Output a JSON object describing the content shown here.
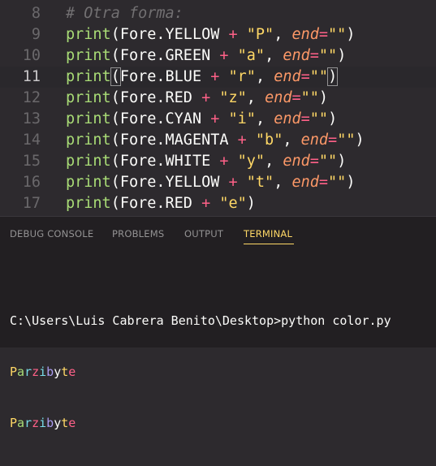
{
  "editor": {
    "lines": [
      {
        "num": "8",
        "parts": [
          {
            "t": "# Otra forma:",
            "c": "cm"
          }
        ]
      },
      {
        "num": "9",
        "parts": [
          {
            "t": "print",
            "c": "kw"
          },
          {
            "t": "(Fore.YELLOW ",
            "c": "pl"
          },
          {
            "t": "+",
            "c": "op"
          },
          {
            "t": " \"P\"",
            "c": "str"
          },
          {
            "t": ", ",
            "c": "pl"
          },
          {
            "t": "end",
            "c": "arg"
          },
          {
            "t": "=",
            "c": "op"
          },
          {
            "t": "\"\"",
            "c": "str"
          },
          {
            "t": ")",
            "c": "pl"
          }
        ]
      },
      {
        "num": "10",
        "parts": [
          {
            "t": "print",
            "c": "kw"
          },
          {
            "t": "(Fore.GREEN ",
            "c": "pl"
          },
          {
            "t": "+",
            "c": "op"
          },
          {
            "t": " \"a\"",
            "c": "str"
          },
          {
            "t": ", ",
            "c": "pl"
          },
          {
            "t": "end",
            "c": "arg"
          },
          {
            "t": "=",
            "c": "op"
          },
          {
            "t": "\"\"",
            "c": "str"
          },
          {
            "t": ")",
            "c": "pl"
          }
        ]
      },
      {
        "num": "11",
        "parts": [
          {
            "t": "print",
            "c": "kw"
          },
          {
            "t": "(",
            "c": "pl bracket-box"
          },
          {
            "t": "Fore.BLUE ",
            "c": "pl"
          },
          {
            "t": "+",
            "c": "op"
          },
          {
            "t": " \"r\"",
            "c": "str"
          },
          {
            "t": ", ",
            "c": "pl"
          },
          {
            "t": "end",
            "c": "arg"
          },
          {
            "t": "=",
            "c": "op"
          },
          {
            "t": "\"\"",
            "c": "str"
          },
          {
            "t": ")",
            "c": "pl bracket-box"
          }
        ]
      },
      {
        "num": "12",
        "parts": [
          {
            "t": "print",
            "c": "kw"
          },
          {
            "t": "(Fore.RED ",
            "c": "pl"
          },
          {
            "t": "+",
            "c": "op"
          },
          {
            "t": " \"z\"",
            "c": "str"
          },
          {
            "t": ", ",
            "c": "pl"
          },
          {
            "t": "end",
            "c": "arg"
          },
          {
            "t": "=",
            "c": "op"
          },
          {
            "t": "\"\"",
            "c": "str"
          },
          {
            "t": ")",
            "c": "pl"
          }
        ]
      },
      {
        "num": "13",
        "parts": [
          {
            "t": "print",
            "c": "kw"
          },
          {
            "t": "(Fore.CYAN ",
            "c": "pl"
          },
          {
            "t": "+",
            "c": "op"
          },
          {
            "t": " \"i\"",
            "c": "str"
          },
          {
            "t": ", ",
            "c": "pl"
          },
          {
            "t": "end",
            "c": "arg"
          },
          {
            "t": "=",
            "c": "op"
          },
          {
            "t": "\"\"",
            "c": "str"
          },
          {
            "t": ")",
            "c": "pl"
          }
        ]
      },
      {
        "num": "14",
        "parts": [
          {
            "t": "print",
            "c": "kw"
          },
          {
            "t": "(Fore.MAGENTA ",
            "c": "pl"
          },
          {
            "t": "+",
            "c": "op"
          },
          {
            "t": " \"b\"",
            "c": "str"
          },
          {
            "t": ", ",
            "c": "pl"
          },
          {
            "t": "end",
            "c": "arg"
          },
          {
            "t": "=",
            "c": "op"
          },
          {
            "t": "\"\"",
            "c": "str"
          },
          {
            "t": ")",
            "c": "pl"
          }
        ]
      },
      {
        "num": "15",
        "parts": [
          {
            "t": "print",
            "c": "kw"
          },
          {
            "t": "(Fore.WHITE ",
            "c": "pl"
          },
          {
            "t": "+",
            "c": "op"
          },
          {
            "t": " \"y\"",
            "c": "str"
          },
          {
            "t": ", ",
            "c": "pl"
          },
          {
            "t": "end",
            "c": "arg"
          },
          {
            "t": "=",
            "c": "op"
          },
          {
            "t": "\"\"",
            "c": "str"
          },
          {
            "t": ")",
            "c": "pl"
          }
        ]
      },
      {
        "num": "16",
        "parts": [
          {
            "t": "print",
            "c": "kw"
          },
          {
            "t": "(Fore.YELLOW ",
            "c": "pl"
          },
          {
            "t": "+",
            "c": "op"
          },
          {
            "t": " \"t\"",
            "c": "str"
          },
          {
            "t": ", ",
            "c": "pl"
          },
          {
            "t": "end",
            "c": "arg"
          },
          {
            "t": "=",
            "c": "op"
          },
          {
            "t": "\"\"",
            "c": "str"
          },
          {
            "t": ")",
            "c": "pl"
          }
        ]
      },
      {
        "num": "17",
        "parts": [
          {
            "t": "print",
            "c": "kw"
          },
          {
            "t": "(Fore.RED ",
            "c": "pl"
          },
          {
            "t": "+",
            "c": "op"
          },
          {
            "t": " \"e\"",
            "c": "str"
          },
          {
            "t": ")",
            "c": "pl"
          }
        ]
      }
    ],
    "current_line": "11"
  },
  "panel": {
    "tabs": [
      {
        "label": "DEBUG CONSOLE",
        "active": false
      },
      {
        "label": "PROBLEMS",
        "active": false
      },
      {
        "label": "OUTPUT",
        "active": false
      },
      {
        "label": "TERMINAL",
        "active": true
      }
    ],
    "terminal": {
      "prompt_line": "C:\\Users\\Luis Cabrera Benito\\Desktop>python color.py",
      "output_lines": [
        [
          {
            "ch": "P",
            "color": "#ffd866"
          },
          {
            "ch": "a",
            "color": "#a9dc76"
          },
          {
            "ch": "r",
            "color": "#78dce8"
          },
          {
            "ch": "z",
            "color": "#ff6188"
          },
          {
            "ch": "i",
            "color": "#78dce8"
          },
          {
            "ch": "b",
            "color": "#ab9df2"
          },
          {
            "ch": "y",
            "color": "#fcfcfa"
          },
          {
            "ch": "t",
            "color": "#ffd866"
          },
          {
            "ch": "e",
            "color": "#ff6188"
          }
        ],
        [
          {
            "ch": "P",
            "color": "#ffd866"
          },
          {
            "ch": "a",
            "color": "#a9dc76"
          },
          {
            "ch": "r",
            "color": "#78dce8"
          },
          {
            "ch": "z",
            "color": "#ff6188"
          },
          {
            "ch": "i",
            "color": "#78dce8"
          },
          {
            "ch": "b",
            "color": "#ab9df2"
          },
          {
            "ch": "y",
            "color": "#fcfcfa"
          },
          {
            "ch": "t",
            "color": "#ffd866"
          },
          {
            "ch": "e",
            "color": "#ff6188"
          }
        ]
      ]
    }
  }
}
